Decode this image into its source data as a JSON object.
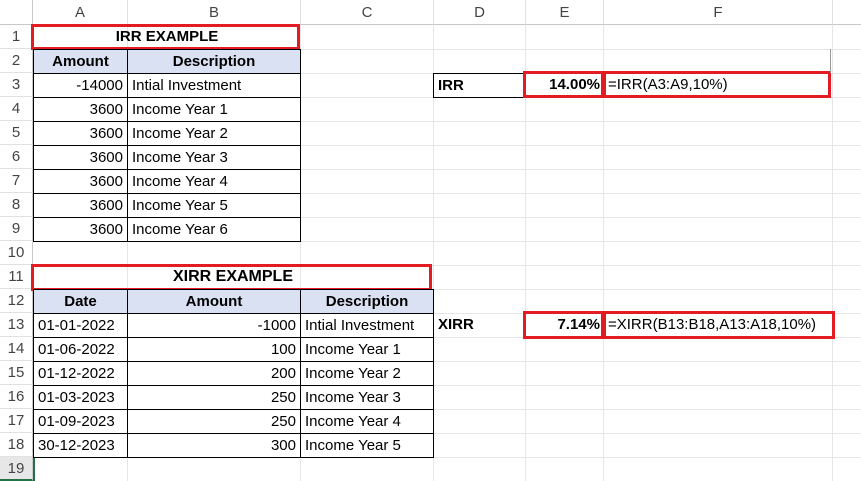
{
  "columns": [
    "A",
    "B",
    "C",
    "D",
    "E",
    "F"
  ],
  "rows": [
    "1",
    "2",
    "3",
    "4",
    "5",
    "6",
    "7",
    "8",
    "9",
    "10",
    "11",
    "12",
    "13",
    "14",
    "15",
    "16",
    "17",
    "18",
    "19"
  ],
  "irr": {
    "title": "IRR EXAMPLE",
    "headers": [
      "Amount",
      "Description"
    ],
    "rows": [
      {
        "amount": "-14000",
        "desc": "Intial Investment"
      },
      {
        "amount": "3600",
        "desc": "Income Year 1"
      },
      {
        "amount": "3600",
        "desc": "Income Year 2"
      },
      {
        "amount": "3600",
        "desc": "Income Year 3"
      },
      {
        "amount": "3600",
        "desc": "Income Year 4"
      },
      {
        "amount": "3600",
        "desc": "Income Year 5"
      },
      {
        "amount": "3600",
        "desc": "Income Year 6"
      }
    ],
    "label": "IRR",
    "result": "14.00%",
    "formula": "=IRR(A3:A9,10%)"
  },
  "xirr": {
    "title": "XIRR EXAMPLE",
    "headers": [
      "Date",
      "Amount",
      "Description"
    ],
    "rows": [
      {
        "date": "01-01-2022",
        "amount": "-1000",
        "desc": "Intial Investment"
      },
      {
        "date": "01-06-2022",
        "amount": "100",
        "desc": "Income Year 1"
      },
      {
        "date": "01-12-2022",
        "amount": "200",
        "desc": "Income Year 2"
      },
      {
        "date": "01-03-2023",
        "amount": "250",
        "desc": "Income Year 3"
      },
      {
        "date": "01-09-2023",
        "amount": "250",
        "desc": "Income Year 4"
      },
      {
        "date": "30-12-2023",
        "amount": "300",
        "desc": "Income Year 5"
      }
    ],
    "label": "XIRR",
    "result": "7.14%",
    "formula": "=XIRR(B13:B18,A13:A18,10%)"
  },
  "colors": {
    "highlight_border": "#e31b23",
    "header_fill": "#d9e1f2",
    "selection": "#217346"
  }
}
